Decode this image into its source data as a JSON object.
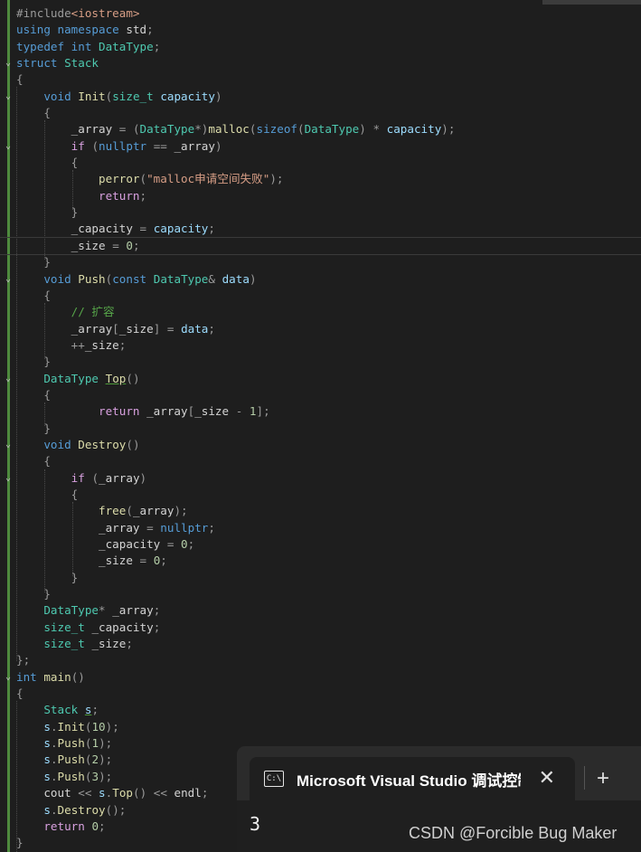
{
  "editor": {
    "include_directive": "#include",
    "include_target": "<iostream>",
    "kw_using": "using",
    "kw_namespace": "namespace",
    "ns_std": "std",
    "kw_typedef": "typedef",
    "kw_int": "int",
    "type_datatype": "DataType",
    "kw_struct": "struct",
    "type_stack": "Stack",
    "kw_void": "void",
    "fn_init": "Init",
    "type_size_t": "size_t",
    "param_capacity": "capacity",
    "mem_array": "_array",
    "mem_size": "_size",
    "mem_capacity": "_capacity",
    "fn_malloc": "malloc",
    "kw_sizeof": "sizeof",
    "kw_if": "if",
    "kw_nullptr": "nullptr",
    "fn_perror": "perror",
    "str_malloc_fail": "\"malloc申请空间失败\"",
    "kw_return": "return",
    "num_0": "0",
    "num_1": "1",
    "fn_push": "Push",
    "kw_const": "const",
    "param_data": "data",
    "comment_expand": "// 扩容",
    "fn_top": "Top",
    "fn_destroy": "Destroy",
    "fn_free": "free",
    "fn_main": "main",
    "var_s": "s",
    "num_10": "10",
    "num_2": "2",
    "num_3": "3",
    "id_cout": "cout",
    "id_endl": "endl"
  },
  "console": {
    "tab_title": "Microsoft Visual Studio 调试控制台",
    "icon_text": "C:\\",
    "close_glyph": "✕",
    "new_tab_glyph": "+",
    "output": "3",
    "watermark": "CSDN @Forcible Bug Maker"
  },
  "colors": {
    "background": "#1e1e1e",
    "keyword": "#569cd6",
    "type": "#4ec9b0",
    "function": "#dcdcaa",
    "string": "#d69d85",
    "number": "#b5cea8",
    "comment": "#57a64a",
    "change_bar": "#4e8a3e"
  }
}
